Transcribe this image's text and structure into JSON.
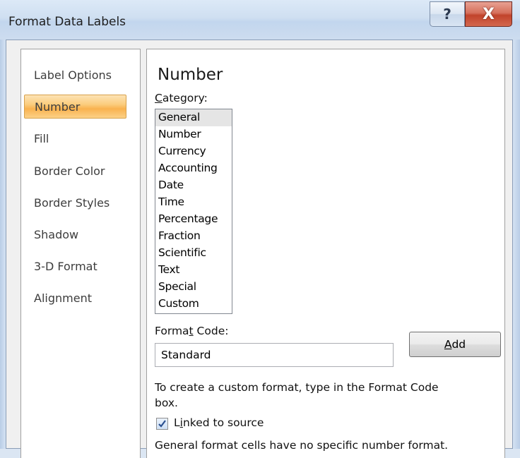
{
  "window": {
    "title": "Format Data Labels",
    "help_glyph": "?",
    "close_glyph": "X"
  },
  "sidebar": {
    "items": [
      {
        "label": "Label Options"
      },
      {
        "label": "Number"
      },
      {
        "label": "Fill"
      },
      {
        "label": "Border Color"
      },
      {
        "label": "Border Styles"
      },
      {
        "label": "Shadow"
      },
      {
        "label": "3-D Format"
      },
      {
        "label": "Alignment"
      }
    ],
    "selected": "Number",
    "selected_color": "#f9b24f"
  },
  "number_panel": {
    "heading": "Number",
    "category_label_pre": "",
    "category_label_key": "C",
    "category_label_post": "ategory:",
    "categories": [
      "General",
      "Number",
      "Currency",
      "Accounting",
      "Date",
      "Time",
      "Percentage",
      "Fraction",
      "Scientific",
      "Text",
      "Special",
      "Custom"
    ],
    "selected_category": "General",
    "format_code_label_pre": "Forma",
    "format_code_label_key": "t",
    "format_code_label_post": " Code:",
    "format_code_value": "Standard",
    "add_label_key": "A",
    "add_label_post": "dd",
    "hint_line1": "To create a custom format, type in the Format Code",
    "hint_line2": "box.",
    "linked_label_pre": "L",
    "linked_label_key": "i",
    "linked_label_post": "nked to source",
    "linked_checked": true,
    "footer_text": "General format cells have no specific number format."
  }
}
